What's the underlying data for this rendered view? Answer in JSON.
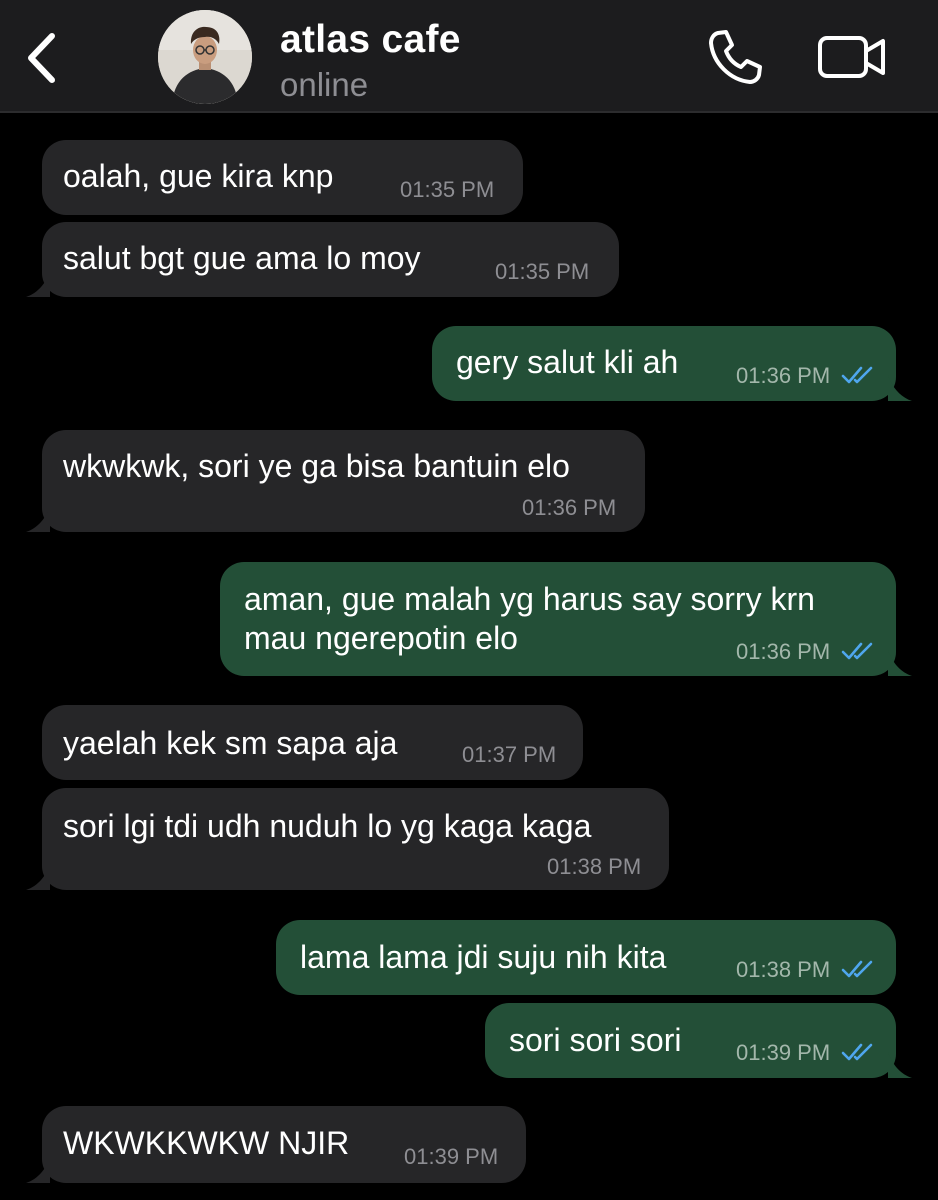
{
  "header": {
    "contact_name": "atlas cafe",
    "contact_status": "online",
    "back_icon": "chevron-left-icon",
    "call_icon": "phone-icon",
    "video_icon": "video-camera-icon"
  },
  "colors": {
    "background": "#000000",
    "incoming_bubble": "#262628",
    "outgoing_bubble": "#234f37",
    "read_ticks": "#4fa6ee",
    "timestamp": "#8e8e93"
  },
  "messages": [
    {
      "direction": "in",
      "text": "oalah, gue kira knp",
      "time": "01:35 PM"
    },
    {
      "direction": "in",
      "text": "salut bgt gue ama lo moy",
      "time": "01:35 PM"
    },
    {
      "direction": "out",
      "text": "gery salut kli ah",
      "time": "01:36 PM",
      "status": "read"
    },
    {
      "direction": "in",
      "text": "wkwkwk, sori ye ga bisa bantuin elo",
      "time": "01:36 PM"
    },
    {
      "direction": "out",
      "text_line1": "aman, gue malah yg harus say sorry krn",
      "text_line2": "mau ngerepotin elo",
      "time": "01:36 PM",
      "status": "read"
    },
    {
      "direction": "in",
      "text": "yaelah kek sm sapa aja",
      "time": "01:37 PM"
    },
    {
      "direction": "in",
      "text": "sori lgi tdi udh nuduh lo yg kaga kaga",
      "time": "01:38 PM"
    },
    {
      "direction": "out",
      "text": "lama lama jdi suju nih kita",
      "time": "01:38 PM",
      "status": "read"
    },
    {
      "direction": "out",
      "text": "sori sori sori",
      "time": "01:39 PM",
      "status": "read"
    },
    {
      "direction": "in",
      "text": "WKWKKWKW NJIR",
      "time": "01:39 PM"
    }
  ]
}
